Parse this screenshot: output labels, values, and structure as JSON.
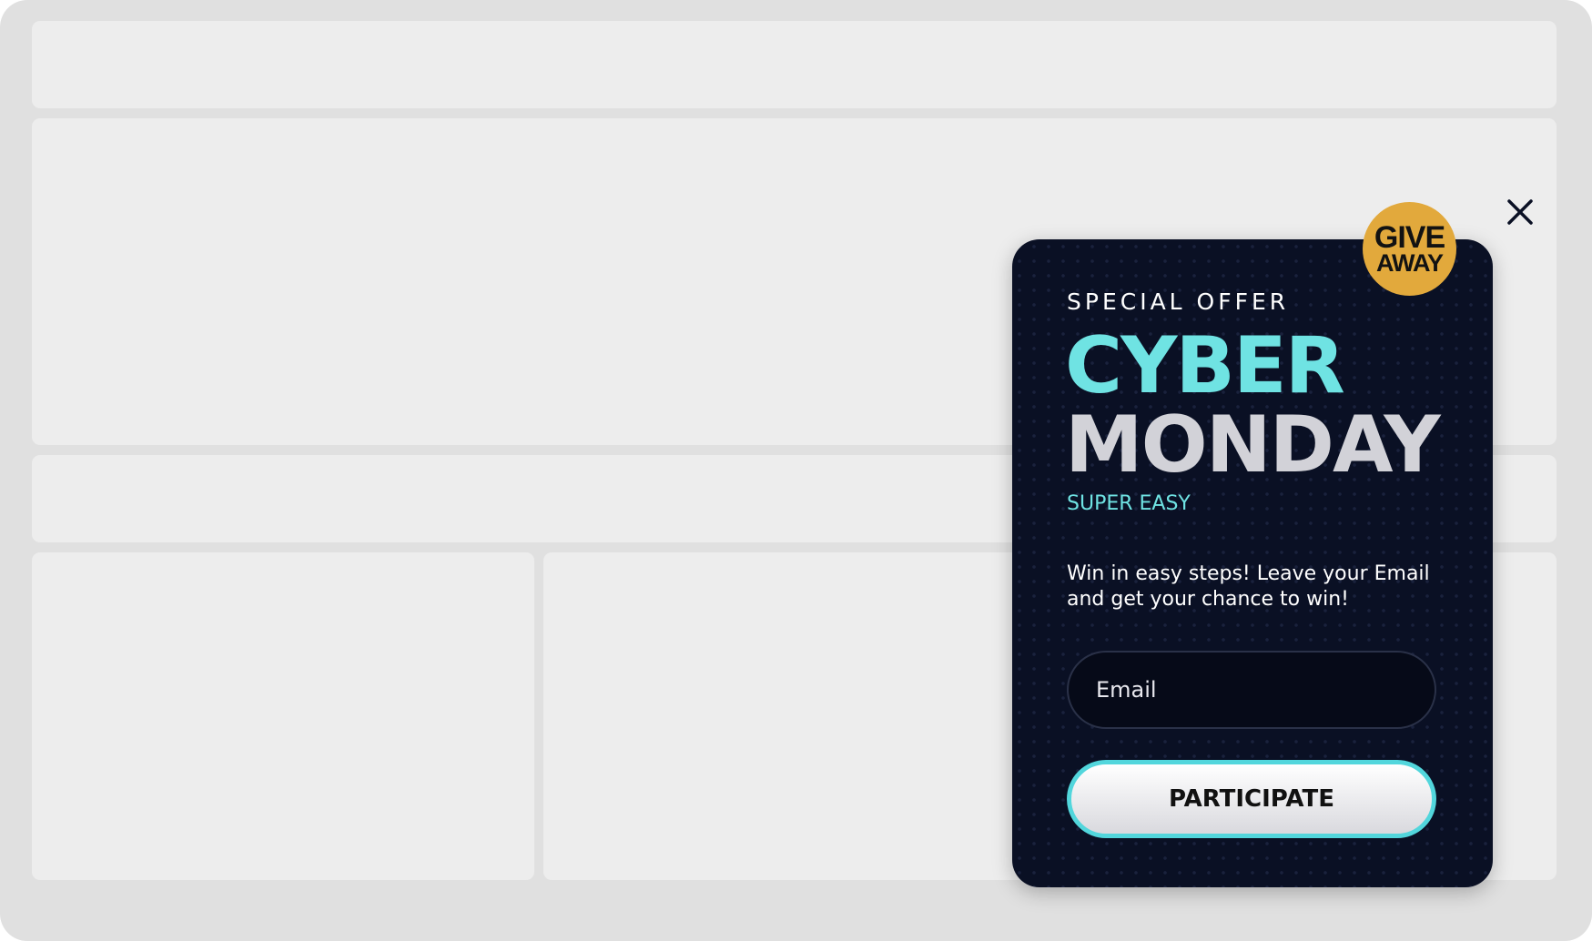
{
  "popup": {
    "badge_line1": "GIVE",
    "badge_line2": "AWAY",
    "eyebrow": "SPECIAL OFFER",
    "title_line1": "CYBER",
    "title_line2": "MONDAY",
    "tagline": "SUPER EASY",
    "description": "Win in easy steps! Leave your Email and get your chance to win!",
    "email_placeholder": "Email",
    "email_value": "",
    "cta_label": "PARTICIPATE",
    "close_icon": "close-icon"
  },
  "colors": {
    "page_frame": "#e0e0e0",
    "placeholder_block": "#ededed",
    "popup_bg": "#0a1024",
    "accent_cyan": "#6fe3e3",
    "badge_gold": "#e2a93c",
    "title_gray": "#d2d2d8",
    "button_border": "#52d6dc"
  }
}
